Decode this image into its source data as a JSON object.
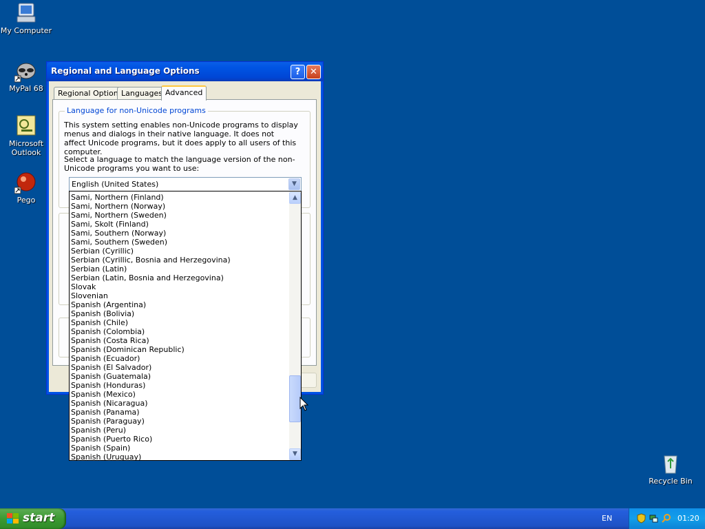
{
  "desktop": {
    "icons": [
      {
        "label": "My Computer"
      },
      {
        "label": "MyPal 68"
      },
      {
        "label": "Microsoft Outlook"
      },
      {
        "label": "Pego"
      },
      {
        "label": "Recycle Bin"
      }
    ]
  },
  "dialog": {
    "title": "Regional and Language Options",
    "help_label": "?",
    "close_label": "✕",
    "tabs": [
      "Regional Options",
      "Languages",
      "Advanced"
    ],
    "active_tab": "Advanced",
    "group_title": "Language for non-Unicode programs",
    "paragraph1": "This system setting enables non-Unicode programs to display menus and dialogs in their native language. It does not affect Unicode programs, but it does apply to all users of this computer.",
    "paragraph2": "Select a language to match the language version of the non-Unicode programs you want to use:",
    "selected_language": "English (United States)",
    "dropdown_items": [
      "Sami, Northern (Finland)",
      "Sami, Northern (Norway)",
      "Sami, Northern (Sweden)",
      "Sami, Skolt (Finland)",
      "Sami, Southern (Norway)",
      "Sami, Southern (Sweden)",
      "Serbian (Cyrillic)",
      "Serbian (Cyrillic, Bosnia and Herzegovina)",
      "Serbian (Latin)",
      "Serbian (Latin, Bosnia and Herzegovina)",
      "Slovak",
      "Slovenian",
      "Spanish (Argentina)",
      "Spanish (Bolivia)",
      "Spanish (Chile)",
      "Spanish (Colombia)",
      "Spanish (Costa Rica)",
      "Spanish (Dominican Republic)",
      "Spanish (Ecuador)",
      "Spanish (El Salvador)",
      "Spanish (Guatemala)",
      "Spanish (Honduras)",
      "Spanish (Mexico)",
      "Spanish (Nicaragua)",
      "Spanish (Panama)",
      "Spanish (Paraguay)",
      "Spanish (Peru)",
      "Spanish (Puerto Rico)",
      "Spanish (Spain)",
      "Spanish (Uruguay)"
    ]
  },
  "taskbar": {
    "start_label": "start",
    "language": "EN",
    "clock": "01:20"
  },
  "colors": {
    "desktop": "#004e98",
    "titlebar": "#0054e3",
    "taskbar": "#245edc",
    "start": "#3c9a32"
  }
}
